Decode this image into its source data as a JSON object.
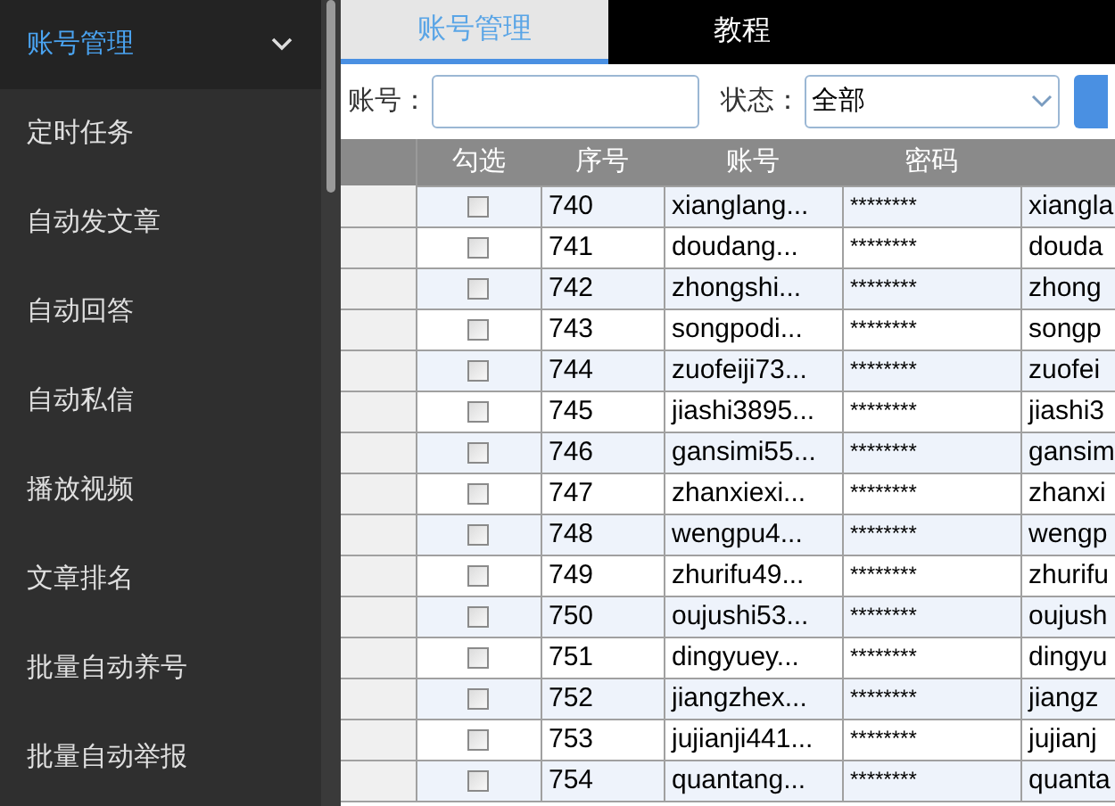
{
  "sidebar": {
    "items": [
      {
        "label": "账号管理",
        "selected": true,
        "expanded": true
      },
      {
        "label": "定时任务",
        "selected": false
      },
      {
        "label": "自动发文章",
        "selected": false
      },
      {
        "label": "自动回答",
        "selected": false
      },
      {
        "label": "自动私信",
        "selected": false
      },
      {
        "label": "播放视频",
        "selected": false
      },
      {
        "label": "文章排名",
        "selected": false
      },
      {
        "label": "批量自动养号",
        "selected": false
      },
      {
        "label": "批量自动举报",
        "selected": false
      }
    ]
  },
  "tabs": [
    {
      "label": "账号管理",
      "selected": true
    },
    {
      "label": "教程",
      "selected": false
    }
  ],
  "search": {
    "account_label": "账号：",
    "status_label": "状态：",
    "status_value": "全部"
  },
  "table": {
    "columns": [
      "勾选",
      "序号",
      "账号",
      "密码"
    ],
    "rows": [
      {
        "checked": false,
        "no": "740",
        "account": "xianglang...",
        "password": "********",
        "column_5": "xiangla"
      },
      {
        "checked": false,
        "no": "741",
        "account": "doudang...",
        "password": "********",
        "column_5": "douda"
      },
      {
        "checked": false,
        "no": "742",
        "account": "zhongshi...",
        "password": "********",
        "column_5": "zhong"
      },
      {
        "checked": false,
        "no": "743",
        "account": "songpodi...",
        "password": "********",
        "column_5": "songp"
      },
      {
        "checked": false,
        "no": "744",
        "account": "zuofeiji73...",
        "password": "********",
        "column_5": "zuofei"
      },
      {
        "checked": false,
        "no": "745",
        "account": "jiashi3895...",
        "password": "********",
        "column_5": "jiashi3"
      },
      {
        "checked": false,
        "no": "746",
        "account": "gansimi55...",
        "password": "********",
        "column_5": "gansim"
      },
      {
        "checked": false,
        "no": "747",
        "account": "zhanxiexi...",
        "password": "********",
        "column_5": "zhanxi"
      },
      {
        "checked": false,
        "no": "748",
        "account": "wengpu4...",
        "password": "********",
        "column_5": "wengp"
      },
      {
        "checked": false,
        "no": "749",
        "account": "zhurifu49...",
        "password": "********",
        "column_5": "zhurifu"
      },
      {
        "checked": false,
        "no": "750",
        "account": "oujushi53...",
        "password": "********",
        "column_5": "oujush"
      },
      {
        "checked": false,
        "no": "751",
        "account": "dingyuey...",
        "password": "********",
        "column_5": "dingyu"
      },
      {
        "checked": false,
        "no": "752",
        "account": "jiangzhex...",
        "password": "********",
        "column_5": "jiangz"
      },
      {
        "checked": false,
        "no": "753",
        "account": "jujianji441...",
        "password": "********",
        "column_5": "jujianj"
      },
      {
        "checked": false,
        "no": "754",
        "account": "quantang...",
        "password": "********",
        "column_5": "quanta"
      }
    ]
  }
}
